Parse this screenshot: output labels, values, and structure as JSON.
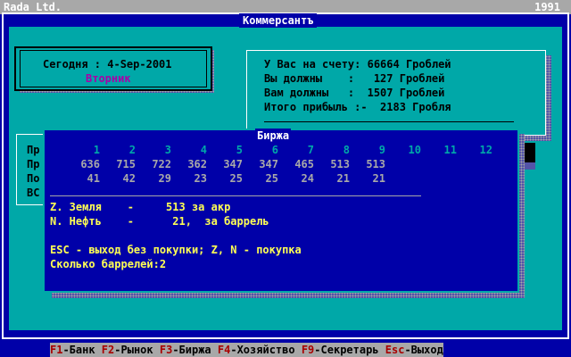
{
  "topbar": {
    "company": "Rada Ltd.",
    "year": "1991"
  },
  "window": {
    "title": "Коммерсантъ"
  },
  "date_panel": {
    "line": "Сегодня : 4-Sep-2001",
    "weekday": "Вторник"
  },
  "account": {
    "rows": [
      "У Вас на счету: 66664 Гроблей",
      "Вы должны    :   127 Гроблей",
      "Вам должны   :  1507 Гроблей",
      "Итого прибыль :-  2183 Гробля"
    ]
  },
  "left_panel": {
    "labels": [
      "Пр",
      "Пр",
      "По",
      "ВС"
    ]
  },
  "exchange": {
    "title": "Биржа",
    "columns": [
      "1",
      "2",
      "3",
      "4",
      "5",
      "6",
      "7",
      "8",
      "9",
      "10",
      "11",
      "12"
    ],
    "land_prices": [
      "636",
      "715",
      "722",
      "362",
      "347",
      "347",
      "465",
      "513",
      "513",
      "",
      "",
      ""
    ],
    "oil_prices": [
      "41",
      "42",
      "29",
      "23",
      "25",
      "25",
      "24",
      "21",
      "21",
      "",
      "",
      ""
    ],
    "land_line": "Z. Земля    -     513 за акр",
    "oil_line": "N. Нефть    -      21,  за баррель",
    "hint": "ESC - выход без покупки; Z, N - покупка",
    "prompt": "Сколько баррелей:2"
  },
  "function_keys": [
    {
      "key": "F1",
      "label": "-Банк"
    },
    {
      "key": "F2",
      "label": "-Рынок"
    },
    {
      "key": "F3",
      "label": "-Биржа"
    },
    {
      "key": "F4",
      "label": "-Хозяйство"
    },
    {
      "key": "F9",
      "label": "-Секретарь"
    },
    {
      "key": "Esc",
      "label": "-Выход"
    }
  ]
}
